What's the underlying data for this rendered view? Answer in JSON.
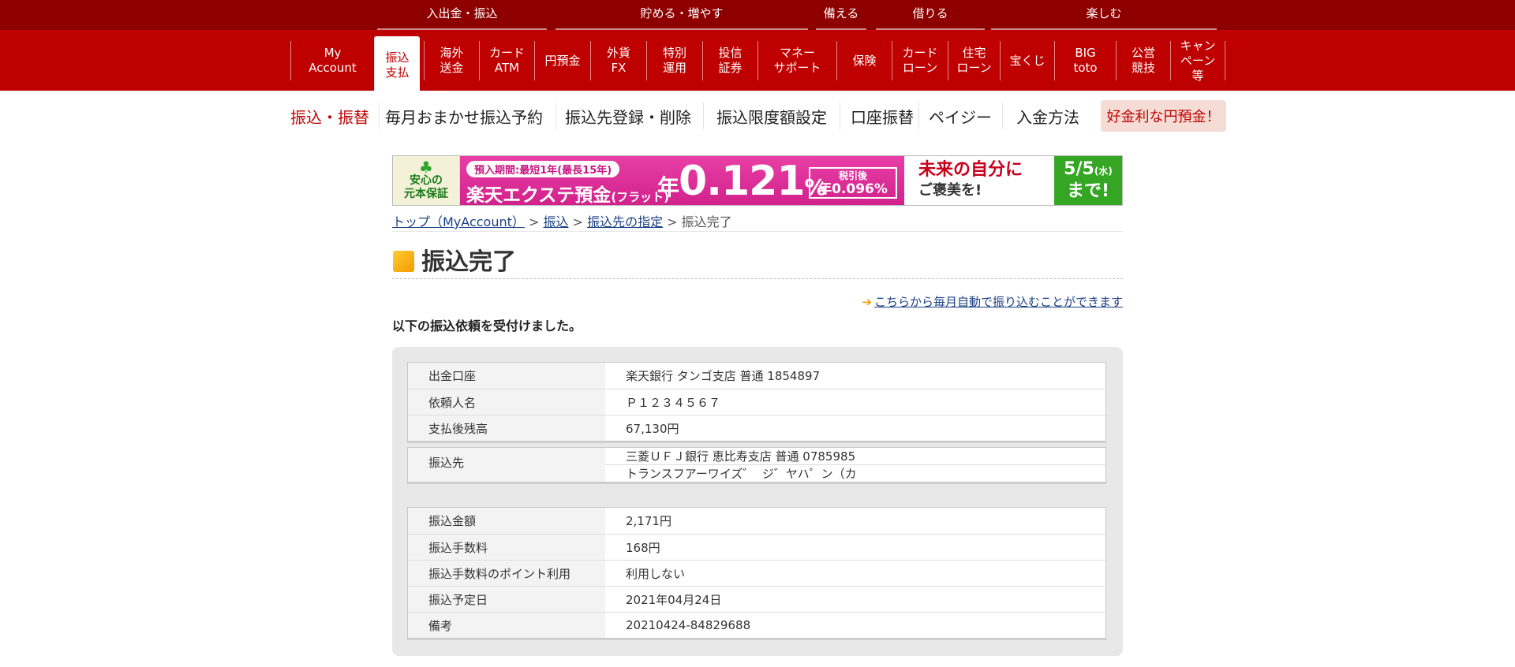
{
  "categories": [
    "入出金・振込",
    "貯める・増やす",
    "備える",
    "借りる",
    "楽しむ"
  ],
  "nav": [
    "My\nAccount",
    "振込\n支払",
    "海外\n送金",
    "カード\nATM",
    "円預金",
    "外貨\nFX",
    "特別\n運用",
    "投信\n証券",
    "マネー\nサポート",
    "保険",
    "カード\nローン",
    "住宅\nローン",
    "宝くじ",
    "BIG\ntoto",
    "公営\n競技",
    "キャン\nペーン\n等"
  ],
  "subnav": [
    "振込・振替",
    "毎月おまかせ振込予約",
    "振込先登録・削除",
    "振込限度額設定",
    "口座振替",
    "ペイジー",
    "入金方法",
    "好金利な円預金！"
  ],
  "banner": {
    "guarantee_top": "安心の",
    "guarantee_bottom": "元本保証",
    "period": "預入期間:最短1年(最長15年)",
    "product": "楽天エクステ預金",
    "product_sub": "(フラット)",
    "rate_prefix": "年",
    "rate": "0.121",
    "rate_unit": "%",
    "after_tax_label": "税引後",
    "after_tax": "年0.096%",
    "catch_line1": "未来の自分に",
    "catch_line2": "ご褒美を!",
    "deadline_date": "5/5",
    "deadline_day": "(水)",
    "deadline_until": "まで!"
  },
  "breadcrumb": {
    "top": "トップ（MyAccount）",
    "transfer": "振込",
    "select": "振込先の指定",
    "current": "振込完了",
    "sep": " > "
  },
  "page_title": "振込完了",
  "auto_link": "こちらから毎月自動で振り込むことができます",
  "received_msg": "以下の振込依頼を受付けました。",
  "table1": [
    {
      "k": "出金口座",
      "v": "楽天銀行 タンゴ支店 普通 1854897"
    },
    {
      "k": "依頼人名",
      "v": "Ｐ１２３４５６７"
    },
    {
      "k": "支払後残高",
      "v": "67,130円"
    }
  ],
  "table2": {
    "k": "振込先",
    "v1": "三菱ＵＦＪ銀行 恵比寿支店 普通 0785985",
    "v2": "トランスフアーワイズ゛  ジ゛ヤハ゜ン（カ"
  },
  "table3": [
    {
      "k": "振込金額",
      "v": "2,171円"
    },
    {
      "k": "振込手数料",
      "v": "168円"
    },
    {
      "k": "振込手数料のポイント利用",
      "v": "利用しない"
    },
    {
      "k": "振込予定日",
      "v": "2021年04月24日"
    },
    {
      "k": "備考",
      "v": "20210424-84829688"
    }
  ]
}
